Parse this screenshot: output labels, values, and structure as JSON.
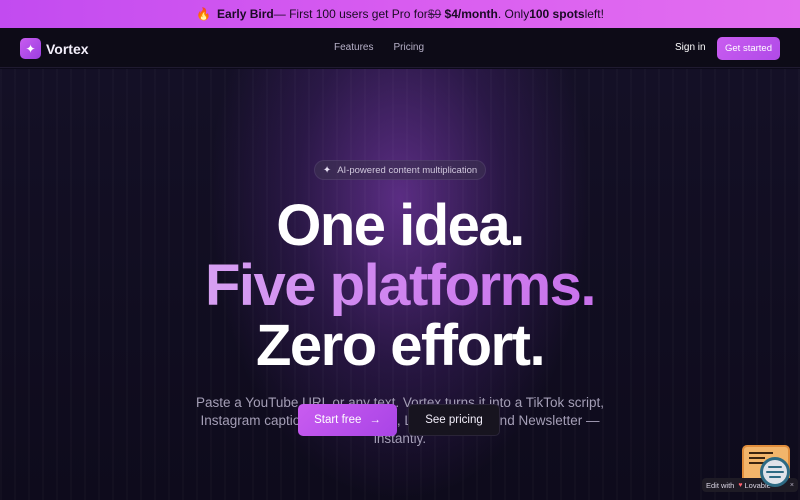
{
  "promo": {
    "icon": "fire-icon",
    "label": "Early Bird",
    "text_before": " — First 100 users get Pro for ",
    "old_price": "$9",
    "new_price": "$4/month",
    "text_middle": ". Only ",
    "spots": "100 spots",
    "text_after": " left!"
  },
  "nav": {
    "brand": "Vortex",
    "links": [
      "Features",
      "Pricing"
    ],
    "signin": "Sign in",
    "cta": "Get started"
  },
  "hero": {
    "badge": "AI-powered content multiplication",
    "line1": "One idea.",
    "line2": "Five platforms.",
    "line3": "Zero effort.",
    "subtitle": "Paste a YouTube URL or any text. Vortex turns it into a TikTok script, Instagram caption, Twitter thread, LinkedIn post, and Newsletter — instantly.",
    "primary_cta": "Start free",
    "secondary_cta": "See pricing"
  },
  "lovable": {
    "label": "Edit with",
    "brand": "Lovable"
  },
  "colors": {
    "accent": "#c95cf0",
    "background": "#0c0a1a"
  }
}
